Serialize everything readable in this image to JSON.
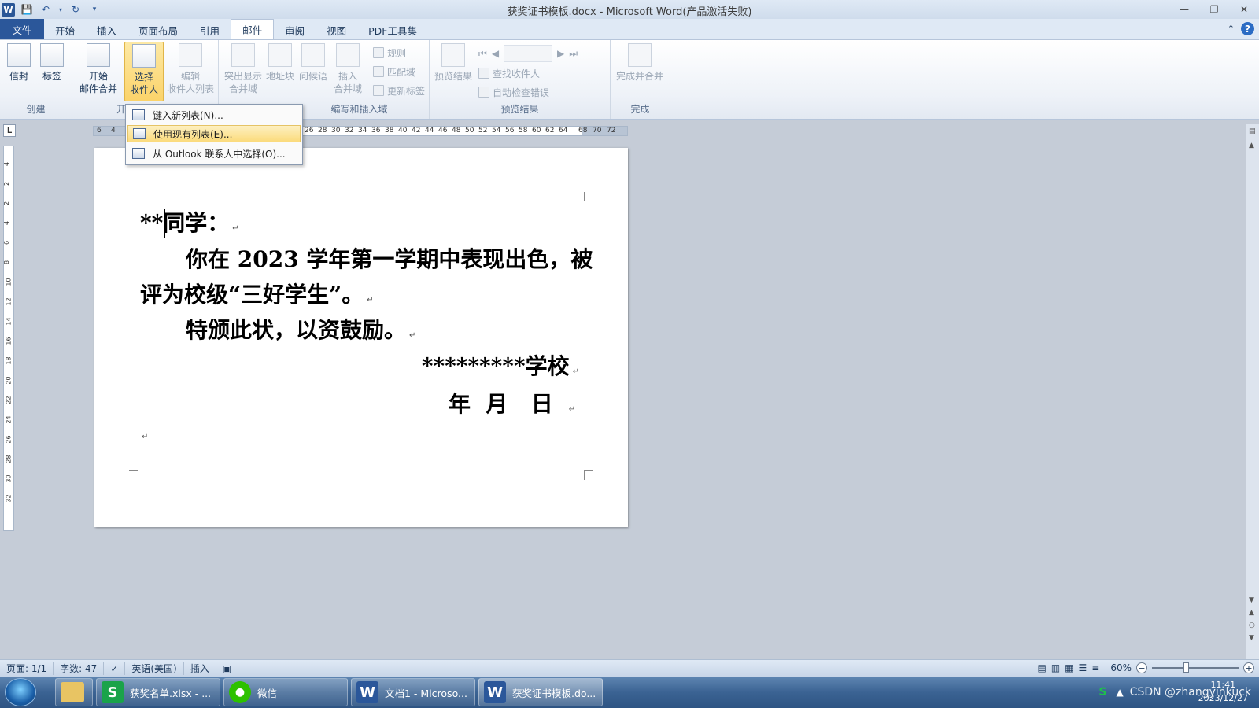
{
  "window": {
    "title": "获奖证书模板.docx - Microsoft Word(产品激活失败)",
    "logo": "W"
  },
  "tabs": [
    "文件",
    "开始",
    "插入",
    "页面布局",
    "引用",
    "邮件",
    "审阅",
    "视图",
    "PDF工具集"
  ],
  "ribbon": {
    "create": {
      "label": "创建",
      "envelope": "信封",
      "labels": "标签"
    },
    "start": {
      "label_cut": "开",
      "start_merge": [
        "开始",
        "邮件合并"
      ],
      "select_recipients": [
        "选择",
        "收件人"
      ],
      "edit_recipients": [
        "编辑",
        "收件人列表"
      ]
    },
    "write": {
      "label": "编写和插入域",
      "highlight": [
        "突出显示",
        "合并域"
      ],
      "address_block": "地址块",
      "greeting": "问候语",
      "insert_field": [
        "插入",
        "合并域"
      ],
      "rules": "规则",
      "match_fields": "匹配域",
      "update_labels": "更新标签"
    },
    "preview": {
      "label": "预览结果",
      "preview_results": "预览结果",
      "find_recipient": "查找收件人",
      "auto_check": "自动检查错误"
    },
    "finish": {
      "label": "完成",
      "finish_merge": "完成并合并"
    }
  },
  "dropdown": {
    "items": [
      "键入新列表(N)...",
      "使用现有列表(E)...",
      "从 Outlook 联系人中选择(O)..."
    ]
  },
  "ruler": {
    "h_ticks": [
      "6",
      "4",
      "26",
      "28",
      "30",
      "32",
      "34",
      "36",
      "38",
      "40",
      "42",
      "44",
      "46",
      "48",
      "50",
      "52",
      "54",
      "56",
      "58",
      "60",
      "62",
      "64",
      "68",
      "70",
      "72"
    ],
    "v_ticks": [
      "4",
      "2",
      "2",
      "4",
      "6",
      "8",
      "10",
      "12",
      "14",
      "16",
      "18",
      "20",
      "22",
      "24",
      "26",
      "28",
      "30",
      "32"
    ]
  },
  "document": {
    "line1": "**同学：",
    "line2": "你在 2023 学年第一学期中表现出色，被",
    "line3": "评为校级“三好学生”。",
    "line4": "特颁此状，以资鼓励。",
    "line5": "*********学校",
    "line6": "年  月   日"
  },
  "status": {
    "page": "页面: 1/1",
    "words": "字数: 47",
    "language": "英语(美国)",
    "mode": "插入",
    "zoom": "60%"
  },
  "taskbar": {
    "items": [
      {
        "label": "获奖名单.xlsx - ...",
        "icon": "S"
      },
      {
        "label": "微信",
        "icon": "wechat"
      },
      {
        "label": "文档1 - Microso...",
        "icon": "W"
      },
      {
        "label": "获奖证书模板.do...",
        "icon": "W"
      }
    ],
    "tray_text": "CSDN @zhangyinkuck",
    "time": "11:41",
    "date": "2023/12/27"
  },
  "colors": {
    "accent": "#2b579a",
    "highlight": "#fbd36a"
  }
}
